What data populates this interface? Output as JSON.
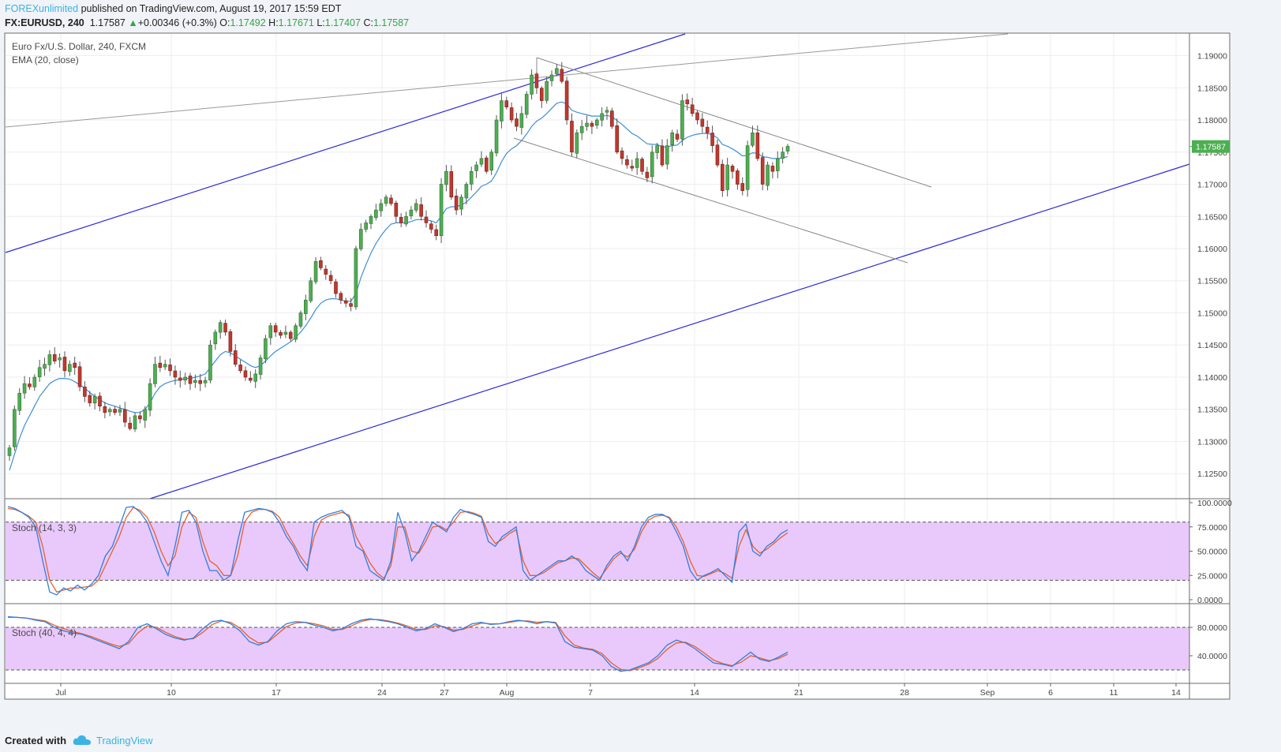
{
  "header": {
    "author": "FOREXunlimited",
    "published_text": "published on TradingView.com, August 19, 2017 15:59 EDT",
    "symbol": "FX:EURUSD, 240",
    "last": "1.17587",
    "change_arrow": "▲",
    "change": "+0.00346 (+0.3%)",
    "o_label": "O:",
    "o_value": "1.17492",
    "h_label": "H:",
    "h_value": "1.17671",
    "l_label": "L:",
    "l_value": "1.17407",
    "c_label": "C:",
    "c_value": "1.17587"
  },
  "footer": {
    "created_with": "Created with",
    "brand": "TradingView"
  },
  "chart_data": [
    {
      "type": "candlestick",
      "legend": [
        "Euro Fx/U.S. Dollar, 240, FXCM",
        "EMA (20, close)"
      ],
      "x_ticks": [
        "Jul",
        "10",
        "17",
        "24",
        "27",
        "Aug",
        "7",
        "14",
        "21",
        "28",
        "Sep",
        "6",
        "11",
        "14"
      ],
      "y_ticks": [
        "1.19000",
        "1.18500",
        "1.18000",
        "1.17500",
        "1.17000",
        "1.16500",
        "1.16000",
        "1.15500",
        "1.15000",
        "1.14500",
        "1.14000",
        "1.13500",
        "1.13000",
        "1.12500"
      ],
      "ylim": [
        1.1211,
        1.1935
      ],
      "last_price_label": "1.17587",
      "closes": [
        1.129,
        1.135,
        1.1375,
        1.139,
        1.1385,
        1.14,
        1.1415,
        1.142,
        1.1435,
        1.1425,
        1.143,
        1.141,
        1.142,
        1.1415,
        1.1385,
        1.137,
        1.136,
        1.137,
        1.1355,
        1.1345,
        1.135,
        1.1345,
        1.135,
        1.133,
        1.132,
        1.134,
        1.1335,
        1.135,
        1.139,
        1.142,
        1.1415,
        1.142,
        1.141,
        1.14,
        1.1395,
        1.14,
        1.139,
        1.1395,
        1.139,
        1.1395,
        1.145,
        1.147,
        1.1485,
        1.147,
        1.144,
        1.142,
        1.141,
        1.14,
        1.1395,
        1.1405,
        1.143,
        1.146,
        1.148,
        1.147,
        1.1465,
        1.147,
        1.146,
        1.148,
        1.15,
        1.152,
        1.155,
        1.158,
        1.157,
        1.156,
        1.155,
        1.153,
        1.152,
        1.1515,
        1.151,
        1.16,
        1.163,
        1.164,
        1.165,
        1.166,
        1.167,
        1.168,
        1.167,
        1.165,
        1.164,
        1.165,
        1.166,
        1.167,
        1.165,
        1.164,
        1.163,
        1.162,
        1.17,
        1.172,
        1.168,
        1.166,
        1.168,
        1.17,
        1.172,
        1.173,
        1.174,
        1.172,
        1.175,
        1.18,
        1.183,
        1.182,
        1.18,
        1.179,
        1.181,
        1.184,
        1.187,
        1.185,
        1.183,
        1.186,
        1.187,
        1.188,
        1.186,
        1.18,
        1.175,
        1.178,
        1.179,
        1.1795,
        1.179,
        1.18,
        1.181,
        1.1815,
        1.179,
        1.175,
        1.174,
        1.173,
        1.1725,
        1.174,
        1.172,
        1.171,
        1.175,
        1.176,
        1.173,
        1.176,
        1.178,
        1.177,
        1.183,
        1.1825,
        1.181,
        1.18,
        1.179,
        1.178,
        1.176,
        1.173,
        1.169,
        1.173,
        1.172,
        1.17,
        1.169,
        1.176,
        1.178,
        1.174,
        1.17,
        1.173,
        1.172,
        1.174,
        1.175,
        1.1759
      ],
      "ema": [
        1.1255,
        1.128,
        1.1305,
        1.1325,
        1.134,
        1.1355,
        1.137,
        1.138,
        1.139,
        1.1395,
        1.1398,
        1.1398,
        1.1397,
        1.1393,
        1.1388,
        1.1383,
        1.1376,
        1.137,
        1.1365,
        1.136,
        1.1357,
        1.1355,
        1.1352,
        1.135,
        1.1347,
        1.1345,
        1.1345,
        1.135,
        1.136,
        1.1375,
        1.1385,
        1.139,
        1.1393,
        1.1395,
        1.1396,
        1.1398,
        1.1398,
        1.14,
        1.1402,
        1.1405,
        1.1415,
        1.1425,
        1.1435,
        1.144,
        1.1438,
        1.1433,
        1.1428,
        1.1423,
        1.1418,
        1.1415,
        1.1418,
        1.1425,
        1.1433,
        1.144,
        1.1445,
        1.145,
        1.1455,
        1.1462,
        1.147,
        1.148,
        1.1492,
        1.1505,
        1.1515,
        1.152,
        1.1522,
        1.1522,
        1.152,
        1.1518,
        1.1518,
        1.153,
        1.1555,
        1.1575,
        1.1593,
        1.1608,
        1.162,
        1.163,
        1.1638,
        1.164,
        1.164,
        1.164,
        1.1642,
        1.1645,
        1.1645,
        1.1645,
        1.1643,
        1.164,
        1.165,
        1.1662,
        1.1665,
        1.1665,
        1.1668,
        1.1672,
        1.168,
        1.1688,
        1.1697,
        1.17,
        1.1705,
        1.1718,
        1.1735,
        1.1748,
        1.1755,
        1.176,
        1.1768,
        1.1778,
        1.179,
        1.1798,
        1.1803,
        1.181,
        1.1818,
        1.1826,
        1.1828,
        1.1825,
        1.1815,
        1.1812,
        1.181,
        1.1808,
        1.1806,
        1.1806,
        1.1806,
        1.1807,
        1.1805,
        1.1799,
        1.1793,
        1.1786,
        1.1779,
        1.1775,
        1.1769,
        1.1763,
        1.1762,
        1.1762,
        1.1758,
        1.1758,
        1.176,
        1.1761,
        1.1768,
        1.1773,
        1.1776,
        1.1778,
        1.1779,
        1.1779,
        1.1777,
        1.1772,
        1.1762,
        1.1759,
        1.1755,
        1.175,
        1.1744,
        1.1745,
        1.1749,
        1.1748,
        1.1743,
        1.1742,
        1.174,
        1.174,
        1.1741,
        1.1743
      ]
    },
    {
      "type": "line",
      "legend": "Stoch (14, 3, 3)",
      "y_ticks": [
        "100.0000",
        "75.0000",
        "50.0000",
        "25.0000",
        "0.0000"
      ],
      "ylim": [
        0,
        100
      ],
      "band": [
        20,
        80
      ],
      "series": [
        {
          "values": [
            96,
            94,
            90,
            85,
            75,
            40,
            8,
            5,
            12,
            9,
            15,
            10,
            16,
            25,
            45,
            55,
            75,
            95,
            96,
            90,
            80,
            60,
            40,
            25,
            55,
            90,
            92,
            80,
            50,
            30,
            30,
            20,
            25,
            60,
            90,
            92,
            94,
            93,
            90,
            80,
            65,
            55,
            40,
            30,
            80,
            85,
            88,
            90,
            92,
            85,
            55,
            50,
            30,
            25,
            20,
            40,
            90,
            70,
            40,
            50,
            65,
            80,
            75,
            70,
            85,
            93,
            90,
            88,
            85,
            60,
            55,
            65,
            70,
            75,
            30,
            20,
            25,
            30,
            35,
            40,
            40,
            45,
            40,
            30,
            25,
            20,
            35,
            45,
            50,
            40,
            55,
            75,
            85,
            88,
            88,
            84,
            70,
            55,
            30,
            20,
            25,
            28,
            32,
            25,
            18,
            70,
            78,
            50,
            45,
            55,
            60,
            68,
            72
          ]
        },
        {
          "values": [
            94,
            93,
            90,
            86,
            80,
            55,
            20,
            8,
            10,
            12,
            12,
            13,
            14,
            20,
            35,
            50,
            65,
            85,
            95,
            92,
            85,
            70,
            50,
            35,
            45,
            75,
            90,
            85,
            60,
            40,
            35,
            25,
            25,
            45,
            80,
            90,
            93,
            93,
            91,
            85,
            70,
            58,
            45,
            35,
            65,
            82,
            86,
            88,
            90,
            87,
            65,
            52,
            38,
            28,
            22,
            35,
            75,
            75,
            50,
            48,
            60,
            75,
            76,
            72,
            80,
            90,
            91,
            89,
            86,
            68,
            58,
            62,
            68,
            72,
            40,
            25,
            25,
            28,
            33,
            38,
            40,
            43,
            42,
            35,
            28,
            22,
            32,
            42,
            48,
            44,
            52,
            70,
            82,
            86,
            87,
            85,
            75,
            60,
            40,
            25,
            24,
            27,
            30,
            27,
            22,
            55,
            72,
            55,
            48,
            52,
            58,
            64,
            69
          ]
        }
      ]
    },
    {
      "type": "line",
      "legend": "Stoch (40, 4, 4)",
      "y_ticks": [
        "80.0000",
        "40.0000"
      ],
      "ylim": [
        0,
        100
      ],
      "band": [
        20,
        80
      ],
      "series": [
        {
          "values": [
            95,
            94,
            93,
            90,
            88,
            80,
            75,
            72,
            70,
            65,
            60,
            55,
            50,
            60,
            80,
            85,
            78,
            70,
            65,
            62,
            65,
            78,
            88,
            90,
            85,
            75,
            60,
            55,
            60,
            75,
            85,
            88,
            87,
            83,
            80,
            75,
            78,
            85,
            90,
            92,
            90,
            88,
            85,
            80,
            75,
            78,
            85,
            80,
            74,
            78,
            85,
            87,
            84,
            85,
            88,
            90,
            88,
            85,
            88,
            86,
            60,
            52,
            50,
            48,
            40,
            25,
            18,
            20,
            25,
            30,
            40,
            55,
            62,
            58,
            50,
            40,
            30,
            28,
            25,
            35,
            45,
            35,
            32,
            38,
            45
          ]
        },
        {
          "values": [
            94,
            94,
            93,
            91,
            89,
            83,
            78,
            74,
            71,
            67,
            62,
            57,
            53,
            57,
            72,
            82,
            80,
            73,
            67,
            63,
            64,
            73,
            84,
            89,
            87,
            79,
            66,
            58,
            59,
            70,
            81,
            86,
            87,
            85,
            82,
            77,
            77,
            82,
            88,
            91,
            91,
            89,
            86,
            82,
            77,
            77,
            82,
            81,
            76,
            77,
            82,
            86,
            85,
            85,
            87,
            89,
            89,
            87,
            88,
            87,
            68,
            55,
            51,
            49,
            43,
            30,
            21,
            19,
            23,
            28,
            36,
            49,
            58,
            59,
            53,
            44,
            34,
            29,
            26,
            31,
            40,
            37,
            33,
            36,
            42
          ]
        }
      ]
    }
  ]
}
